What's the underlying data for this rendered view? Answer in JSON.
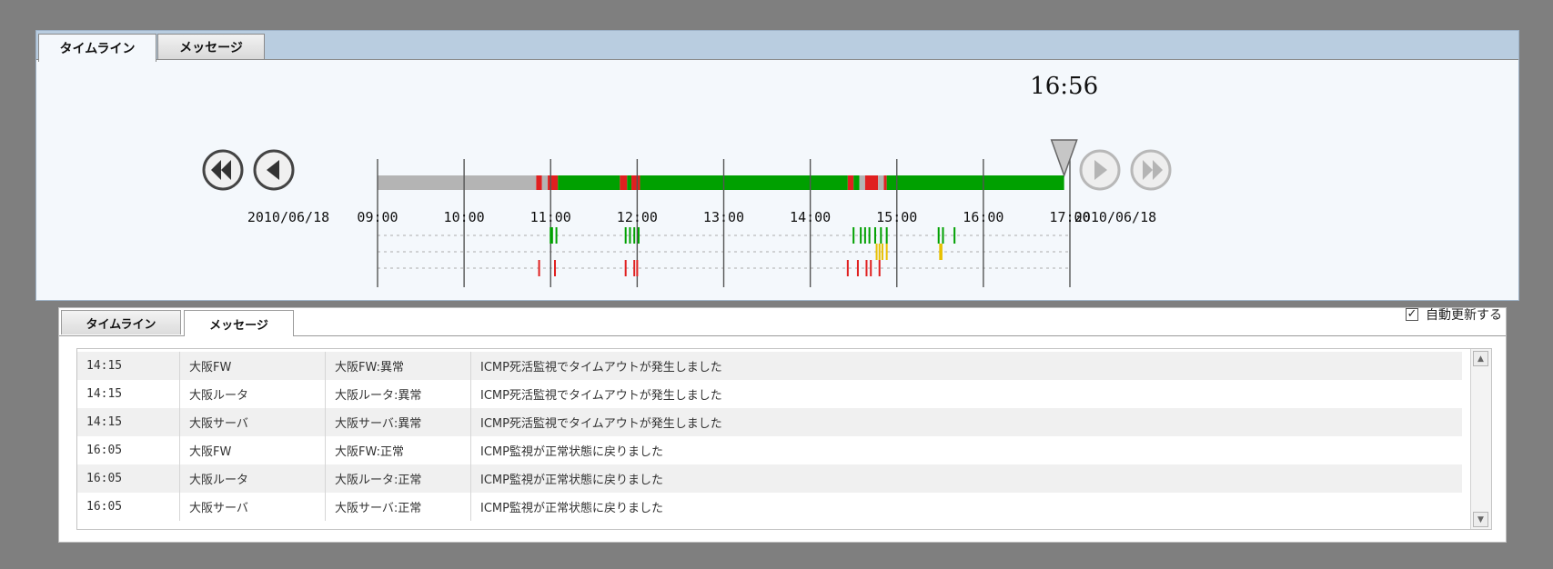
{
  "top_tabs": [
    {
      "label": "タイムライン",
      "active": true
    },
    {
      "label": "メッセージ",
      "active": false
    }
  ],
  "timeline": {
    "current_time": "16:56",
    "start_date": "2010/06/18",
    "end_date": "2010/06/18",
    "tick_labels": [
      "09:00",
      "10:00",
      "11:00",
      "12:00",
      "13:00",
      "14:00",
      "15:00",
      "16:00",
      "17:00"
    ],
    "colors": {
      "normal": "#00a000",
      "error": "#e02020",
      "warning": "#e8c000",
      "no_data": "#b4b4b4"
    },
    "status_bar": [
      {
        "from": "09:00",
        "to": "10:50",
        "status": "no_data"
      },
      {
        "from": "10:50",
        "to": "10:54",
        "status": "error"
      },
      {
        "from": "10:54",
        "to": "10:58",
        "status": "no_data"
      },
      {
        "from": "10:58",
        "to": "11:05",
        "status": "error"
      },
      {
        "from": "11:05",
        "to": "11:48",
        "status": "normal"
      },
      {
        "from": "11:48",
        "to": "11:53",
        "status": "error"
      },
      {
        "from": "11:53",
        "to": "11:56",
        "status": "normal"
      },
      {
        "from": "11:56",
        "to": "12:02",
        "status": "error"
      },
      {
        "from": "12:02",
        "to": "14:26",
        "status": "normal"
      },
      {
        "from": "14:26",
        "to": "14:30",
        "status": "error"
      },
      {
        "from": "14:30",
        "to": "14:34",
        "status": "normal"
      },
      {
        "from": "14:34",
        "to": "14:38",
        "status": "no_data"
      },
      {
        "from": "14:38",
        "to": "14:47",
        "status": "error"
      },
      {
        "from": "14:47",
        "to": "14:51",
        "status": "no_data"
      },
      {
        "from": "14:51",
        "to": "14:53",
        "status": "error"
      },
      {
        "from": "14:53",
        "to": "16:56",
        "status": "normal"
      }
    ],
    "event_lanes": [
      {
        "status": "normal",
        "times": [
          "11:00",
          "11:01",
          "11:04",
          "11:52",
          "11:55",
          "11:58",
          "12:01",
          "14:30",
          "14:35",
          "14:38",
          "14:41",
          "14:45",
          "14:49",
          "14:53",
          "15:29",
          "15:32",
          "15:40"
        ]
      },
      {
        "status": "warning",
        "times": [
          "14:46",
          "14:48",
          "14:50",
          "14:53",
          "15:30",
          "15:31"
        ]
      },
      {
        "status": "error",
        "times": [
          "10:52",
          "11:03",
          "11:52",
          "11:58",
          "12:00",
          "14:26",
          "14:33",
          "14:39",
          "14:42",
          "14:48"
        ]
      }
    ]
  },
  "bottom_tabs": [
    {
      "label": "タイムライン",
      "active": false
    },
    {
      "label": "メッセージ",
      "active": true
    }
  ],
  "auto_update": {
    "label": "自動更新する",
    "checked": true,
    "check_glyph": "✓"
  },
  "messages": [
    {
      "time": "14:15",
      "source": "大阪FW",
      "status": "大阪FW:異常",
      "message": "ICMP死活監視でタイムアウトが発生しました"
    },
    {
      "time": "14:15",
      "source": "大阪ルータ",
      "status": "大阪ルータ:異常",
      "message": "ICMP死活監視でタイムアウトが発生しました"
    },
    {
      "time": "14:15",
      "source": "大阪サーバ",
      "status": "大阪サーバ:異常",
      "message": "ICMP死活監視でタイムアウトが発生しました"
    },
    {
      "time": "16:05",
      "source": "大阪FW",
      "status": "大阪FW:正常",
      "message": "ICMP監視が正常状態に戻りました"
    },
    {
      "time": "16:05",
      "source": "大阪ルータ",
      "status": "大阪ルータ:正常",
      "message": "ICMP監視が正常状態に戻りました"
    },
    {
      "time": "16:05",
      "source": "大阪サーバ",
      "status": "大阪サーバ:正常",
      "message": "ICMP監視が正常状態に戻りました"
    }
  ],
  "icons": {
    "scroll_up": "▲",
    "scroll_down": "▼"
  }
}
